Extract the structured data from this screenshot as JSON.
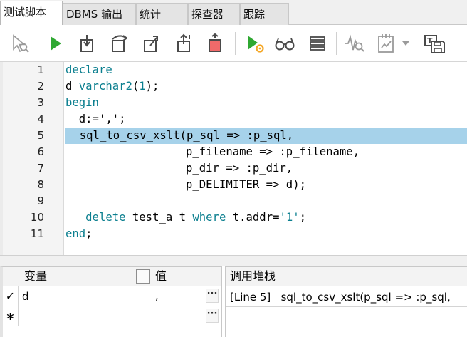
{
  "tabs": [
    {
      "label": "测试脚本",
      "active": true
    },
    {
      "label": "DBMS 输出",
      "active": false
    },
    {
      "label": "统计",
      "active": false
    },
    {
      "label": "探查器",
      "active": false
    },
    {
      "label": "跟踪",
      "active": false
    }
  ],
  "toolbar": {
    "buttons": [
      {
        "icon": "debug-cursor-icon"
      },
      {
        "icon": "run-icon",
        "color": "#2fa832"
      },
      {
        "icon": "step-into-icon"
      },
      {
        "icon": "step-over-icon"
      },
      {
        "icon": "step-out-icon"
      },
      {
        "icon": "run-to-exception-icon"
      },
      {
        "icon": "stop-icon",
        "color": "#f06a6a"
      },
      {
        "icon": "run-with-settings-icon"
      },
      {
        "icon": "glasses-icon"
      },
      {
        "icon": "stack-icon"
      },
      {
        "icon": "waveform-icon"
      },
      {
        "icon": "report-icon"
      },
      {
        "icon": "dropdown-icon"
      },
      {
        "icon": "save-template-icon"
      }
    ]
  },
  "editor": {
    "current_line": 5,
    "highlight_color": "#a6d2ea",
    "keyword_color": "#0b7f8f",
    "lines": [
      {
        "num": "1",
        "segments": [
          {
            "text": "declare",
            "kw": true
          }
        ]
      },
      {
        "num": "2",
        "segments": [
          {
            "text": "d ",
            "kw": false
          },
          {
            "text": "varchar2",
            "kw": true
          },
          {
            "text": "(",
            "kw": false
          },
          {
            "text": "1",
            "kw": true
          },
          {
            "text": ");",
            "kw": false
          }
        ]
      },
      {
        "num": "3",
        "segments": [
          {
            "text": "begin",
            "kw": true
          }
        ]
      },
      {
        "num": "4",
        "segments": [
          {
            "text": "  d:=',';",
            "kw": false
          }
        ]
      },
      {
        "num": "5",
        "segments": [
          {
            "text": "  sql_to_csv_xslt(p_sql => :p_sql,",
            "kw": false
          }
        ]
      },
      {
        "num": "6",
        "segments": [
          {
            "text": "                  p_filename => :p_filename,",
            "kw": false
          }
        ]
      },
      {
        "num": "7",
        "segments": [
          {
            "text": "                  p_dir => :p_dir,",
            "kw": false
          }
        ]
      },
      {
        "num": "8",
        "segments": [
          {
            "text": "                  p_DELIMITER => d);",
            "kw": false
          }
        ]
      },
      {
        "num": "9",
        "segments": [
          {
            "text": "",
            "kw": false
          }
        ]
      },
      {
        "num": "10",
        "segments": [
          {
            "text": "   ",
            "kw": false
          },
          {
            "text": "delete",
            "kw": true
          },
          {
            "text": " test_a t ",
            "kw": false
          },
          {
            "text": "where",
            "kw": true
          },
          {
            "text": " t.addr=",
            "kw": false
          },
          {
            "text": "'1'",
            "kw": true
          },
          {
            "text": ";",
            "kw": false
          }
        ]
      },
      {
        "num": "11",
        "segments": [
          {
            "text": "end",
            "kw": true
          },
          {
            "text": ";",
            "kw": false
          }
        ]
      }
    ]
  },
  "variables": {
    "col_variable": "变量",
    "col_value": "值",
    "rows": [
      {
        "mark": "✓",
        "name": "d",
        "value": ",",
        "button": "···"
      },
      {
        "mark": "∗",
        "name": "",
        "value": "",
        "button": "···"
      }
    ]
  },
  "call_stack": {
    "title": "调用堆栈",
    "entries": [
      "[Line 5]   sql_to_csv_xslt(p_sql => :p_sql,"
    ]
  }
}
